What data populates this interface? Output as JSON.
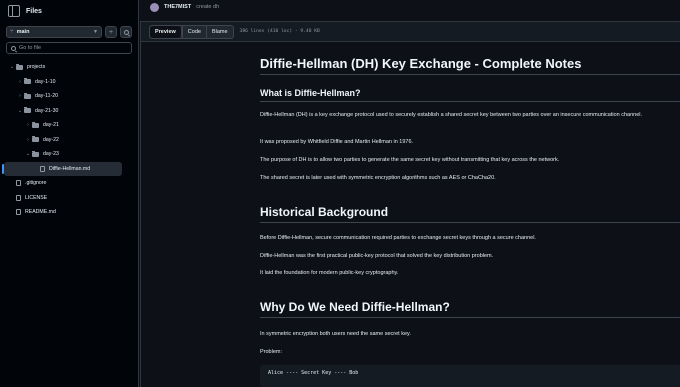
{
  "sidebar": {
    "title": "Files",
    "branch": "main",
    "goto_placeholder": "Go to file",
    "tree": [
      {
        "label": "projects",
        "type": "folder",
        "expanded": true,
        "depth": 0
      },
      {
        "label": "day-1-10",
        "type": "folder",
        "expanded": false,
        "depth": 1
      },
      {
        "label": "day-11-20",
        "type": "folder",
        "expanded": false,
        "depth": 1
      },
      {
        "label": "day-21-30",
        "type": "folder",
        "expanded": true,
        "depth": 1
      },
      {
        "label": "day-21",
        "type": "folder",
        "expanded": false,
        "depth": 2
      },
      {
        "label": "day-22",
        "type": "folder",
        "expanded": false,
        "depth": 2
      },
      {
        "label": "day-23",
        "type": "folder",
        "expanded": true,
        "depth": 2
      },
      {
        "label": "Diffie-Hellman.md",
        "type": "file",
        "selected": true,
        "depth": 3
      },
      {
        "label": ".gitignore",
        "type": "file",
        "depth": 0
      },
      {
        "label": "LICENSE",
        "type": "file",
        "depth": 0
      },
      {
        "label": "README.md",
        "type": "file",
        "depth": 0
      }
    ]
  },
  "header": {
    "author": "THE7MIST",
    "commit_message": "create dh"
  },
  "filebar": {
    "tabs": [
      "Preview",
      "Code",
      "Blame"
    ],
    "active_tab": "Preview",
    "line_info": "386 lines (410 loc) · 9.48 KB"
  },
  "content": {
    "title": "Diffie-Hellman (DH) Key Exchange - Complete Notes",
    "what_heading": "What is Diffie-Hellman?",
    "what_p1": "Diffie-Hellman (DH) is a key exchange protocol used to securely establish a shared secret key between two parties over an insecure communication channel.",
    "what_p2": "It was proposed by Whitfield Diffie and Martin Hellman in 1976.",
    "what_p3": "The purpose of DH is to allow two parties to generate the same secret key without transmitting that key across the network.",
    "what_p4": "The shared secret is later used with symmetric encryption algorithms such as AES or ChaCha20.",
    "history_heading": "Historical Background",
    "history_p1": "Before Diffie-Hellman, secure communication required parties to exchange secret keys through a secure channel.",
    "history_p2": "Diffie-Hellman was the first practical public-key protocol that solved the key distribution problem.",
    "history_p3": "It laid the foundation for modern public-key cryptography.",
    "why_heading": "Why Do We Need Diffie-Hellman?",
    "why_p1": "In symmetric encryption both users need the same secret key.",
    "why_p2": "Problem:",
    "code": "Alice ---- Secret Key ---- Bob"
  }
}
